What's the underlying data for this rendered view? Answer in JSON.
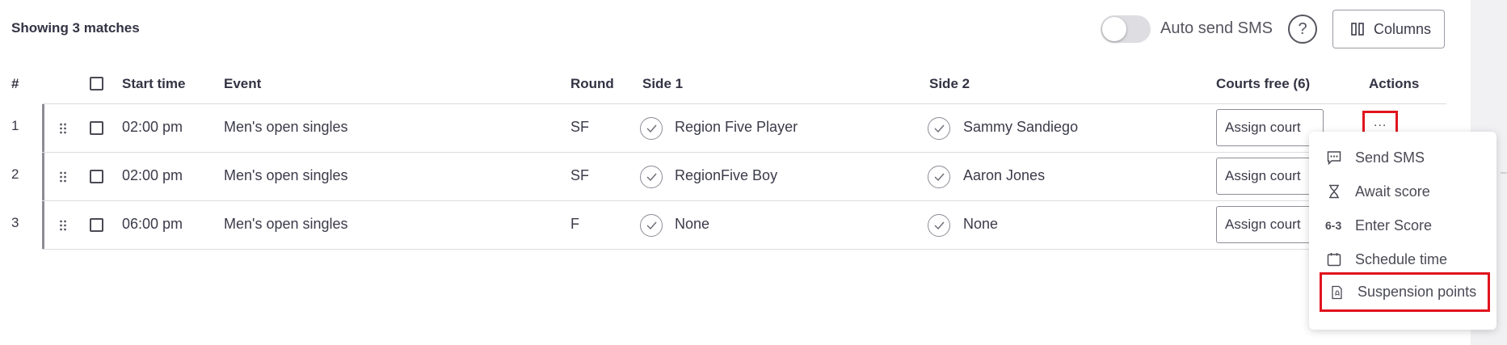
{
  "summary": {
    "showing": "Showing 3 matches"
  },
  "toolbar": {
    "auto_send_sms_label": "Auto send SMS",
    "auto_send_sms_enabled": false,
    "help_icon": "?",
    "columns_label": "Columns"
  },
  "table": {
    "headers": {
      "num": "#",
      "start_time": "Start time",
      "event": "Event",
      "round": "Round",
      "side1": "Side 1",
      "side2": "Side 2",
      "courts_free": "Courts free (6)",
      "actions": "Actions"
    },
    "rows": [
      {
        "num": "1",
        "start_time": "02:00 pm",
        "event": "Men's open singles",
        "round": "SF",
        "side1": "Region Five Player",
        "side2": "Sammy Sandiego",
        "assign": "Assign court"
      },
      {
        "num": "2",
        "start_time": "02:00 pm",
        "event": "Men's open singles",
        "round": "SF",
        "side1": "RegionFive Boy",
        "side2": "Aaron Jones",
        "assign": "Assign court"
      },
      {
        "num": "3",
        "start_time": "06:00 pm",
        "event": "Men's open singles",
        "round": "F",
        "side1": "None",
        "side2": "None",
        "assign": "Assign court"
      }
    ]
  },
  "actions_menu": {
    "trigger": "...",
    "items": [
      {
        "label": "Send SMS",
        "icon": "message-icon"
      },
      {
        "label": "Await score",
        "icon": "hourglass-icon"
      },
      {
        "label": "Enter Score",
        "icon": "score-icon"
      },
      {
        "label": "Schedule time",
        "icon": "calendar-icon"
      },
      {
        "label": "Suspension points",
        "icon": "suspension-icon"
      }
    ],
    "score_icon_text": "6-3"
  },
  "colors": {
    "highlight": "#e0141e",
    "text": "#3b3b4a"
  }
}
